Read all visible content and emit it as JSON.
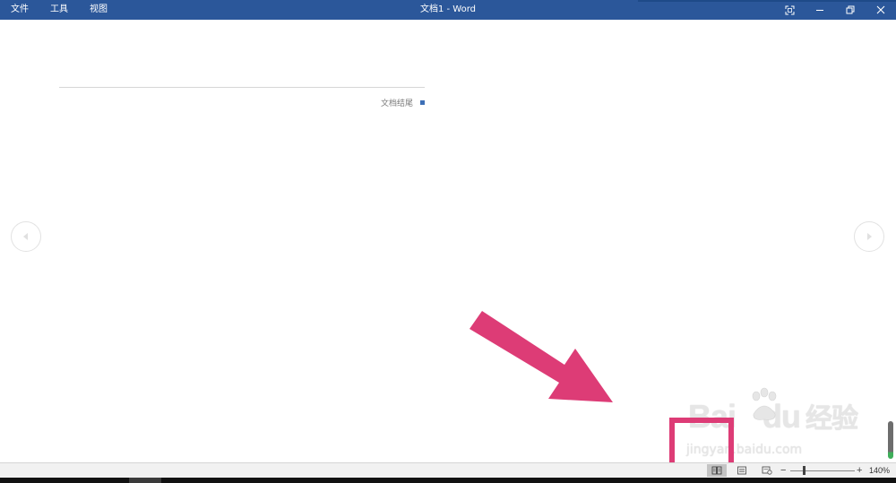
{
  "titlebar": {
    "menu": [
      {
        "label": "文件"
      },
      {
        "label": "工具"
      },
      {
        "label": "视图"
      }
    ],
    "title": "文档1  -  Word",
    "bg_color": "#2b579a",
    "controls": [
      "fullscreen-icon",
      "minimize-icon",
      "restore-icon",
      "close-icon"
    ]
  },
  "document": {
    "end_label": "文档结尾",
    "end_marker_color": "#3d6fb6"
  },
  "navigation": {
    "prev_icon": "chevron-left-icon",
    "next_icon": "chevron-right-icon"
  },
  "annotation": {
    "color": "#dd3c76",
    "arrow_icon": "pointer-arrow-icon"
  },
  "watermark": {
    "brand_left": "Bai",
    "brand_right": "du",
    "brand_cn": "经验",
    "url": "jingyan.baidu.com"
  },
  "statusbar": {
    "views": [
      {
        "name": "read-mode",
        "icon": "book-icon",
        "active": true
      },
      {
        "name": "print-layout",
        "icon": "page-icon",
        "active": false
      },
      {
        "name": "web-layout",
        "icon": "web-page-icon",
        "active": false
      }
    ],
    "zoom_minus": "−",
    "zoom_plus": "+",
    "zoom_level": "140%"
  }
}
